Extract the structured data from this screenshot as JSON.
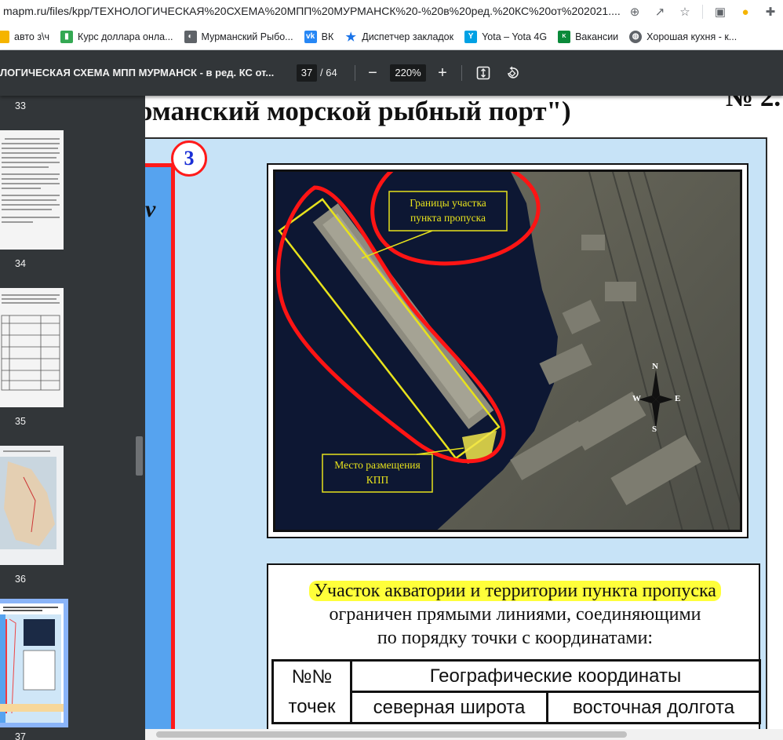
{
  "browser": {
    "url": "mapm.ru/files/kpp/ТЕХНОЛОГИЧЕСКАЯ%20СХЕМА%20МПП%20МУРМАНСК%20-%20в%20ред.%20КС%20от%202021....",
    "bookmarks": [
      {
        "label": "авто з\\ч",
        "icon": "folder-icon",
        "color": "#f5b400"
      },
      {
        "label": "Курс доллара онла...",
        "icon": "chart-icon",
        "color": "#34a853"
      },
      {
        "label": "Мурманский Рыбо...",
        "icon": "fish-icon",
        "color": "#5f6368"
      },
      {
        "label": "ВК",
        "icon": "vk-icon",
        "color": "#2787f5"
      },
      {
        "label": "Диспетчер закладок",
        "icon": "star-icon",
        "color": "#1a73e8"
      },
      {
        "label": "Yota – Yota 4G",
        "icon": "yota-icon",
        "color": "#00a1e4"
      },
      {
        "label": "Вакансии",
        "icon": "kola-icon",
        "color": "#0a8a3a"
      },
      {
        "label": "Хорошая кухня - к...",
        "icon": "globe-icon",
        "color": "#5f6368"
      }
    ]
  },
  "pdf": {
    "title": "ЛОГИЧЕСКАЯ СХЕМА МПП МУРМАНСК - в ред. КС от...",
    "current_page": "37",
    "total_pages": "/ 64",
    "zoom": "220%"
  },
  "thumbnails": [
    {
      "page": "33"
    },
    {
      "page": "34"
    },
    {
      "page": "35"
    },
    {
      "page": "36"
    },
    {
      "page": "37"
    }
  ],
  "document": {
    "heading": "рманский морской рыбный порт\")",
    "heading_right": "№ 2.",
    "circle_number": "3",
    "left_glyph": "v",
    "photo": {
      "label_boundary": "Границы участка пункта пропуска",
      "label_place": "Место размещения КПП",
      "compass": {
        "n": "N",
        "s": "S",
        "e": "E",
        "w": "W"
      }
    },
    "description_line1": "Участок акватории и территории пункта пропуска",
    "description_line2": "ограничен прямыми линиями, соединяющими",
    "description_line3": "по порядку точки с координатами:",
    "table": {
      "col1_header": "№№",
      "col1_sub": "точек",
      "group_header": "Географические координаты",
      "lat_header": "северная широта",
      "lon_header": "восточная долгота"
    }
  }
}
